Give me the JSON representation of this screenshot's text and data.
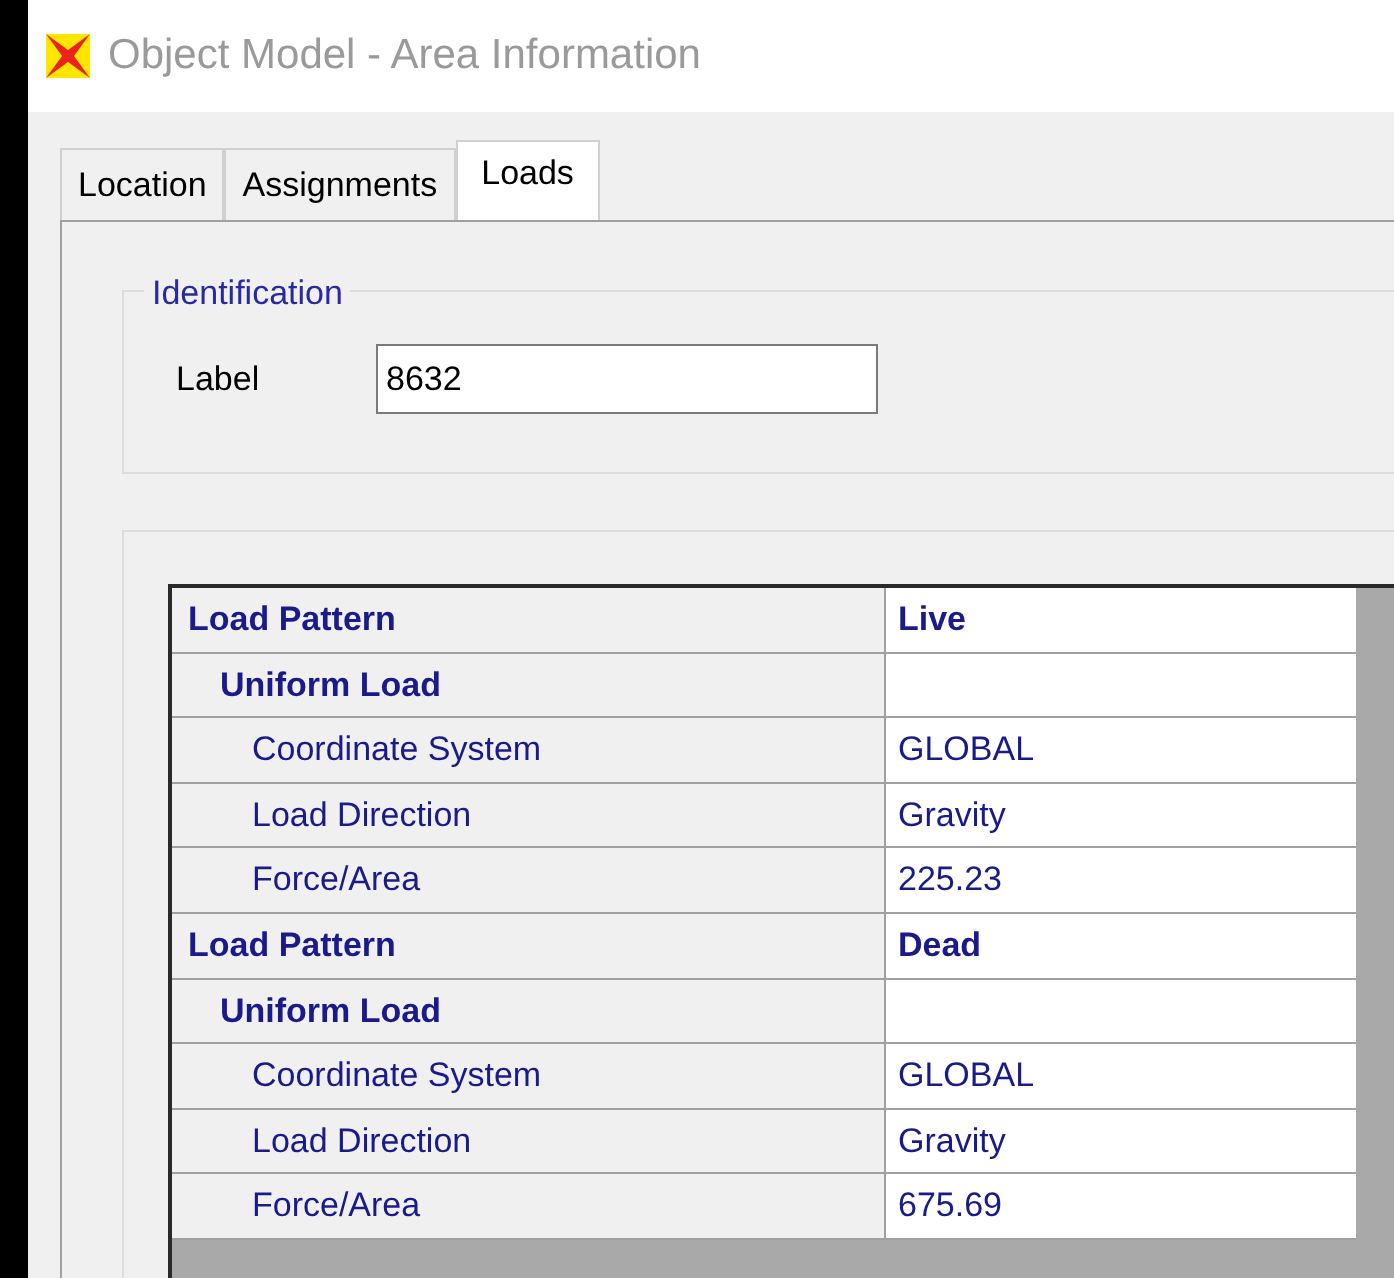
{
  "window": {
    "title": "Object Model - Area Information"
  },
  "tabs": [
    {
      "label": "Location",
      "selected": false
    },
    {
      "label": "Assignments",
      "selected": false
    },
    {
      "label": "Loads",
      "selected": true
    }
  ],
  "identification": {
    "title": "Identification",
    "label": "Label",
    "value": "8632"
  },
  "table": {
    "rows": [
      {
        "name": "Load Pattern",
        "value": "Live",
        "children": [
          {
            "name": "Uniform Load",
            "children": [
              {
                "name": "Coordinate System",
                "value": "GLOBAL"
              },
              {
                "name": "Load Direction",
                "value": "Gravity"
              },
              {
                "name": "Force/Area",
                "value": "225.23"
              }
            ]
          }
        ]
      },
      {
        "name": "Load Pattern",
        "value": "Dead",
        "children": [
          {
            "name": "Uniform Load",
            "children": [
              {
                "name": "Coordinate System",
                "value": "GLOBAL"
              },
              {
                "name": "Load Direction",
                "value": "Gravity"
              },
              {
                "name": "Force/Area",
                "value": "675.69"
              }
            ]
          }
        ]
      }
    ]
  }
}
